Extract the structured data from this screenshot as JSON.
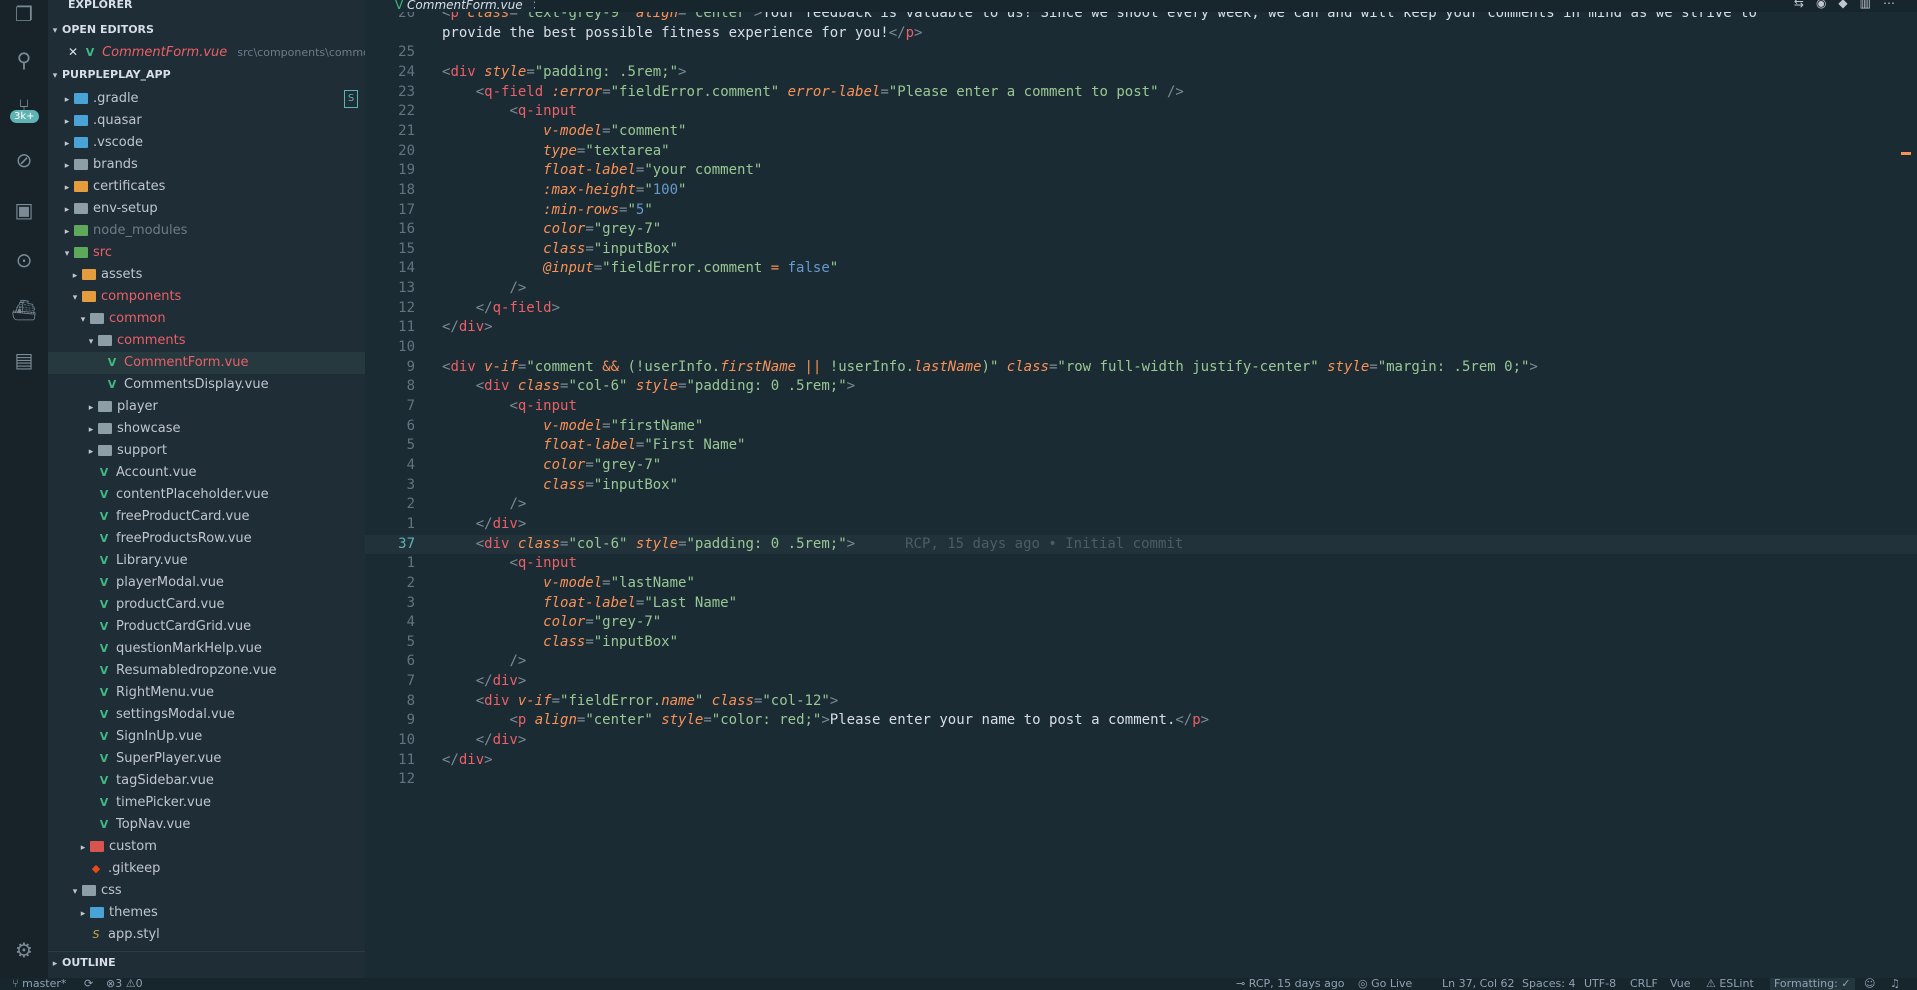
{
  "explorer": {
    "title": "EXPLORER",
    "open_editors_label": "OPEN EDITORS",
    "open_editor": {
      "name": "CommentForm.vue",
      "path": "src\\components\\common\\..."
    },
    "project_label": "PURPLEPLAY_APP",
    "badge": "S",
    "outline_label": "OUTLINE"
  },
  "tree": [
    {
      "label": ".gradle",
      "kind": "folder",
      "color": "blue",
      "twisty": "▸",
      "depth": 1
    },
    {
      "label": ".quasar",
      "kind": "folder",
      "color": "blue",
      "twisty": "▸",
      "depth": 1
    },
    {
      "label": ".vscode",
      "kind": "folder",
      "color": "blue",
      "twisty": "▸",
      "depth": 1
    },
    {
      "label": "brands",
      "kind": "folder",
      "color": "gray",
      "twisty": "▸",
      "depth": 1
    },
    {
      "label": "certificates",
      "kind": "folder",
      "color": "orange",
      "twisty": "▸",
      "depth": 1
    },
    {
      "label": "env-setup",
      "kind": "folder",
      "color": "gray",
      "twisty": "▸",
      "depth": 1
    },
    {
      "label": "node_modules",
      "kind": "folder",
      "color": "green",
      "twisty": "▸",
      "depth": 1,
      "dim": true
    },
    {
      "label": "src",
      "kind": "folder",
      "color": "green",
      "twisty": "▾",
      "depth": 1,
      "red": true
    },
    {
      "label": "assets",
      "kind": "folder",
      "color": "orange",
      "twisty": "▸",
      "depth": 2
    },
    {
      "label": "components",
      "kind": "folder",
      "color": "orange",
      "twisty": "▾",
      "depth": 2,
      "red": true
    },
    {
      "label": "common",
      "kind": "folder",
      "color": "gray",
      "twisty": "▾",
      "depth": 3,
      "red": true
    },
    {
      "label": "comments",
      "kind": "folder",
      "color": "gray",
      "twisty": "▾",
      "depth": 4,
      "red": true
    },
    {
      "label": "CommentForm.vue",
      "kind": "vue",
      "depth": 5,
      "red": true,
      "selected": true
    },
    {
      "label": "CommentsDisplay.vue",
      "kind": "vue",
      "depth": 5
    },
    {
      "label": "player",
      "kind": "folder",
      "color": "gray",
      "twisty": "▸",
      "depth": 4
    },
    {
      "label": "showcase",
      "kind": "folder",
      "color": "gray",
      "twisty": "▸",
      "depth": 4
    },
    {
      "label": "support",
      "kind": "folder",
      "color": "gray",
      "twisty": "▸",
      "depth": 4
    },
    {
      "label": "Account.vue",
      "kind": "vue",
      "depth": 4
    },
    {
      "label": "contentPlaceholder.vue",
      "kind": "vue",
      "depth": 4
    },
    {
      "label": "freeProductCard.vue",
      "kind": "vue",
      "depth": 4
    },
    {
      "label": "freeProductsRow.vue",
      "kind": "vue",
      "depth": 4
    },
    {
      "label": "Library.vue",
      "kind": "vue",
      "depth": 4
    },
    {
      "label": "playerModal.vue",
      "kind": "vue",
      "depth": 4
    },
    {
      "label": "productCard.vue",
      "kind": "vue",
      "depth": 4
    },
    {
      "label": "ProductCardGrid.vue",
      "kind": "vue",
      "depth": 4
    },
    {
      "label": "questionMarkHelp.vue",
      "kind": "vue",
      "depth": 4
    },
    {
      "label": "Resumabledropzone.vue",
      "kind": "vue",
      "depth": 4
    },
    {
      "label": "RightMenu.vue",
      "kind": "vue",
      "depth": 4
    },
    {
      "label": "settingsModal.vue",
      "kind": "vue",
      "depth": 4
    },
    {
      "label": "SignInUp.vue",
      "kind": "vue",
      "depth": 4
    },
    {
      "label": "SuperPlayer.vue",
      "kind": "vue",
      "depth": 4
    },
    {
      "label": "tagSidebar.vue",
      "kind": "vue",
      "depth": 4
    },
    {
      "label": "timePicker.vue",
      "kind": "vue",
      "depth": 4
    },
    {
      "label": "TopNav.vue",
      "kind": "vue",
      "depth": 4
    },
    {
      "label": "custom",
      "kind": "folder",
      "color": "red",
      "twisty": "▸",
      "depth": 3
    },
    {
      "label": ".gitkeep",
      "kind": "git",
      "depth": 3
    },
    {
      "label": "css",
      "kind": "folder",
      "color": "gray",
      "twisty": "▾",
      "depth": 2
    },
    {
      "label": "themes",
      "kind": "folder",
      "color": "blue",
      "twisty": "▸",
      "depth": 3
    },
    {
      "label": "app.styl",
      "kind": "styl",
      "depth": 3
    }
  ],
  "tab": {
    "name": "CommentForm.vue",
    "close": "×"
  },
  "lines": [
    {
      "num": "26",
      "tokens": [
        [
          "br",
          "<"
        ],
        [
          "tag",
          "p"
        ],
        [
          "attr",
          " class"
        ],
        [
          "br",
          "="
        ],
        [
          "str",
          "\"text-grey-9\""
        ],
        [
          "attr",
          " align"
        ],
        [
          "br",
          "="
        ],
        [
          "str",
          "\"center\""
        ],
        [
          "br",
          ">"
        ],
        [
          "txt",
          "Your feedback is valuable to us! Since we shoot every week, we can and will keep your comments in mind as we strive to"
        ]
      ]
    },
    {
      "num": "",
      "tokens": [
        [
          "txt",
          "provide the best possible fitness experience for you!"
        ],
        [
          "br",
          "</"
        ],
        [
          "tag",
          "p"
        ],
        [
          "br",
          ">"
        ]
      ]
    },
    {
      "num": "25",
      "tokens": []
    },
    {
      "num": "24",
      "tokens": [
        [
          "br",
          "<"
        ],
        [
          "tag",
          "div"
        ],
        [
          "attr",
          " style"
        ],
        [
          "br",
          "="
        ],
        [
          "str",
          "\"padding: .5rem;\""
        ],
        [
          "br",
          ">"
        ]
      ]
    },
    {
      "num": "23",
      "tokens": [
        [
          "txt",
          "    "
        ],
        [
          "br",
          "<"
        ],
        [
          "tag",
          "q-field"
        ],
        [
          "attr",
          " :error"
        ],
        [
          "br",
          "="
        ],
        [
          "str",
          "\"fieldError.comment\""
        ],
        [
          "attr",
          " error-label"
        ],
        [
          "br",
          "="
        ],
        [
          "str",
          "\"Please enter a comment to post\""
        ],
        [
          "br",
          " />"
        ]
      ]
    },
    {
      "num": "22",
      "tokens": [
        [
          "txt",
          "        "
        ],
        [
          "br",
          "<"
        ],
        [
          "tag",
          "q-input"
        ]
      ]
    },
    {
      "num": "21",
      "tokens": [
        [
          "txt",
          "            "
        ],
        [
          "attr",
          "v-model"
        ],
        [
          "br",
          "="
        ],
        [
          "str",
          "\"comment\""
        ]
      ]
    },
    {
      "num": "20",
      "tokens": [
        [
          "txt",
          "            "
        ],
        [
          "attr",
          "type"
        ],
        [
          "br",
          "="
        ],
        [
          "str",
          "\"textarea\""
        ]
      ]
    },
    {
      "num": "19",
      "tokens": [
        [
          "txt",
          "            "
        ],
        [
          "attr",
          "float-label"
        ],
        [
          "br",
          "="
        ],
        [
          "str",
          "\"your comment\""
        ]
      ]
    },
    {
      "num": "18",
      "tokens": [
        [
          "txt",
          "            "
        ],
        [
          "attr",
          ":max-height"
        ],
        [
          "br",
          "="
        ],
        [
          "str",
          "\""
        ],
        [
          "num",
          "100"
        ],
        [
          "str",
          "\""
        ]
      ]
    },
    {
      "num": "17",
      "tokens": [
        [
          "txt",
          "            "
        ],
        [
          "attr",
          ":min-rows"
        ],
        [
          "br",
          "="
        ],
        [
          "str",
          "\""
        ],
        [
          "num",
          "5"
        ],
        [
          "str",
          "\""
        ]
      ]
    },
    {
      "num": "16",
      "tokens": [
        [
          "txt",
          "            "
        ],
        [
          "attr",
          "color"
        ],
        [
          "br",
          "="
        ],
        [
          "str",
          "\"grey-7\""
        ]
      ]
    },
    {
      "num": "15",
      "tokens": [
        [
          "txt",
          "            "
        ],
        [
          "attr",
          "class"
        ],
        [
          "br",
          "="
        ],
        [
          "str",
          "\"inputBox\""
        ]
      ]
    },
    {
      "num": "14",
      "tokens": [
        [
          "txt",
          "            "
        ],
        [
          "attr",
          "@input"
        ],
        [
          "br",
          "="
        ],
        [
          "str",
          "\"fieldError.comment "
        ],
        [
          "op",
          "="
        ],
        [
          "num",
          " false"
        ],
        [
          "str",
          "\""
        ]
      ]
    },
    {
      "num": "13",
      "tokens": [
        [
          "txt",
          "        "
        ],
        [
          "br",
          "/>"
        ]
      ]
    },
    {
      "num": "12",
      "tokens": [
        [
          "txt",
          "    "
        ],
        [
          "br",
          "</"
        ],
        [
          "tag",
          "q-field"
        ],
        [
          "br",
          ">"
        ]
      ]
    },
    {
      "num": "11",
      "tokens": [
        [
          "br",
          "</"
        ],
        [
          "tag",
          "div"
        ],
        [
          "br",
          ">"
        ]
      ]
    },
    {
      "num": "10",
      "tokens": []
    },
    {
      "num": "9",
      "tokens": [
        [
          "br",
          "<"
        ],
        [
          "tag",
          "div"
        ],
        [
          "attr",
          " v-if"
        ],
        [
          "br",
          "="
        ],
        [
          "str",
          "\"comment "
        ],
        [
          "op",
          "&&"
        ],
        [
          "str",
          " (!userInfo."
        ],
        [
          "attr",
          "firstName"
        ],
        [
          "op",
          " ||"
        ],
        [
          "str",
          " !userInfo."
        ],
        [
          "attr",
          "lastName"
        ],
        [
          "str",
          ")\""
        ],
        [
          "attr",
          " class"
        ],
        [
          "br",
          "="
        ],
        [
          "str",
          "\"row full-width justify-center\""
        ],
        [
          "attr",
          " style"
        ],
        [
          "br",
          "="
        ],
        [
          "str",
          "\"margin: .5rem 0;\""
        ],
        [
          "br",
          ">"
        ]
      ]
    },
    {
      "num": "8",
      "tokens": [
        [
          "txt",
          "    "
        ],
        [
          "br",
          "<"
        ],
        [
          "tag",
          "div"
        ],
        [
          "attr",
          " class"
        ],
        [
          "br",
          "="
        ],
        [
          "str",
          "\"col-6\""
        ],
        [
          "attr",
          " style"
        ],
        [
          "br",
          "="
        ],
        [
          "str",
          "\"padding: 0 .5rem;\""
        ],
        [
          "br",
          ">"
        ]
      ]
    },
    {
      "num": "7",
      "tokens": [
        [
          "txt",
          "        "
        ],
        [
          "br",
          "<"
        ],
        [
          "tag",
          "q-input"
        ]
      ]
    },
    {
      "num": "6",
      "tokens": [
        [
          "txt",
          "            "
        ],
        [
          "attr",
          "v-model"
        ],
        [
          "br",
          "="
        ],
        [
          "str",
          "\"firstName\""
        ]
      ]
    },
    {
      "num": "5",
      "tokens": [
        [
          "txt",
          "            "
        ],
        [
          "attr",
          "float-label"
        ],
        [
          "br",
          "="
        ],
        [
          "str",
          "\"First Name\""
        ]
      ]
    },
    {
      "num": "4",
      "tokens": [
        [
          "txt",
          "            "
        ],
        [
          "attr",
          "color"
        ],
        [
          "br",
          "="
        ],
        [
          "str",
          "\"grey-7\""
        ]
      ]
    },
    {
      "num": "3",
      "tokens": [
        [
          "txt",
          "            "
        ],
        [
          "attr",
          "class"
        ],
        [
          "br",
          "="
        ],
        [
          "str",
          "\"inputBox\""
        ]
      ]
    },
    {
      "num": "2",
      "tokens": [
        [
          "txt",
          "        "
        ],
        [
          "br",
          "/>"
        ]
      ]
    },
    {
      "num": "1",
      "tokens": [
        [
          "txt",
          "    "
        ],
        [
          "br",
          "</"
        ],
        [
          "tag",
          "div"
        ],
        [
          "br",
          ">"
        ]
      ]
    },
    {
      "num": "37",
      "current": true,
      "tokens": [
        [
          "txt",
          "    "
        ],
        [
          "br",
          "<"
        ],
        [
          "tag",
          "div"
        ],
        [
          "attr",
          " class"
        ],
        [
          "br",
          "="
        ],
        [
          "str",
          "\"col-6\""
        ],
        [
          "attr",
          " style"
        ],
        [
          "br",
          "="
        ],
        [
          "str",
          "\"padding: 0 .5rem;\""
        ],
        [
          "br",
          ">"
        ]
      ],
      "blame": "RCP, 15 days ago • Initial commit"
    },
    {
      "num": "1",
      "tokens": [
        [
          "txt",
          "        "
        ],
        [
          "br",
          "<"
        ],
        [
          "tag",
          "q-input"
        ]
      ]
    },
    {
      "num": "2",
      "tokens": [
        [
          "txt",
          "            "
        ],
        [
          "attr",
          "v-model"
        ],
        [
          "br",
          "="
        ],
        [
          "str",
          "\"lastName\""
        ]
      ]
    },
    {
      "num": "3",
      "tokens": [
        [
          "txt",
          "            "
        ],
        [
          "attr",
          "float-label"
        ],
        [
          "br",
          "="
        ],
        [
          "str",
          "\"Last Name\""
        ]
      ]
    },
    {
      "num": "4",
      "tokens": [
        [
          "txt",
          "            "
        ],
        [
          "attr",
          "color"
        ],
        [
          "br",
          "="
        ],
        [
          "str",
          "\"grey-7\""
        ]
      ]
    },
    {
      "num": "5",
      "tokens": [
        [
          "txt",
          "            "
        ],
        [
          "attr",
          "class"
        ],
        [
          "br",
          "="
        ],
        [
          "str",
          "\"inputBox\""
        ]
      ]
    },
    {
      "num": "6",
      "tokens": [
        [
          "txt",
          "        "
        ],
        [
          "br",
          "/>"
        ]
      ]
    },
    {
      "num": "7",
      "tokens": [
        [
          "txt",
          "    "
        ],
        [
          "br",
          "</"
        ],
        [
          "tag",
          "div"
        ],
        [
          "br",
          ">"
        ]
      ]
    },
    {
      "num": "8",
      "tokens": [
        [
          "txt",
          "    "
        ],
        [
          "br",
          "<"
        ],
        [
          "tag",
          "div"
        ],
        [
          "attr",
          " v-if"
        ],
        [
          "br",
          "="
        ],
        [
          "str",
          "\"fieldError."
        ],
        [
          "attr",
          "name"
        ],
        [
          "str",
          "\""
        ],
        [
          "attr",
          " class"
        ],
        [
          "br",
          "="
        ],
        [
          "str",
          "\"col-12\""
        ],
        [
          "br",
          ">"
        ]
      ]
    },
    {
      "num": "9",
      "tokens": [
        [
          "txt",
          "        "
        ],
        [
          "br",
          "<"
        ],
        [
          "tag",
          "p"
        ],
        [
          "attr",
          " align"
        ],
        [
          "br",
          "="
        ],
        [
          "str",
          "\"center\""
        ],
        [
          "attr",
          " style"
        ],
        [
          "br",
          "="
        ],
        [
          "str",
          "\"color: red;\""
        ],
        [
          "br",
          ">"
        ],
        [
          "txt",
          "Please enter your name to post a comment."
        ],
        [
          "br",
          "</"
        ],
        [
          "tag",
          "p"
        ],
        [
          "br",
          ">"
        ]
      ]
    },
    {
      "num": "10",
      "tokens": [
        [
          "txt",
          "    "
        ],
        [
          "br",
          "</"
        ],
        [
          "tag",
          "div"
        ],
        [
          "br",
          ">"
        ]
      ]
    },
    {
      "num": "11",
      "tokens": [
        [
          "br",
          "</"
        ],
        [
          "tag",
          "div"
        ],
        [
          "br",
          ">"
        ]
      ]
    },
    {
      "num": "12",
      "tokens": []
    }
  ],
  "status": {
    "branch": "master*",
    "errors": "3",
    "warnings": "0",
    "blame": "RCP, 15 days ago",
    "go_live": "Go Live",
    "position": "Ln 37, Col 62",
    "spaces": "Spaces: 4",
    "encoding": "UTF-8",
    "eol": "CRLF",
    "language": "Vue",
    "eslint": "ESLint",
    "formatting": "Formatting: ✓"
  },
  "activity_badge": "3k+",
  "colors": {
    "accent": "#5fb3b3",
    "background": "#1b2b34",
    "sidebar": "#1e2d36"
  }
}
